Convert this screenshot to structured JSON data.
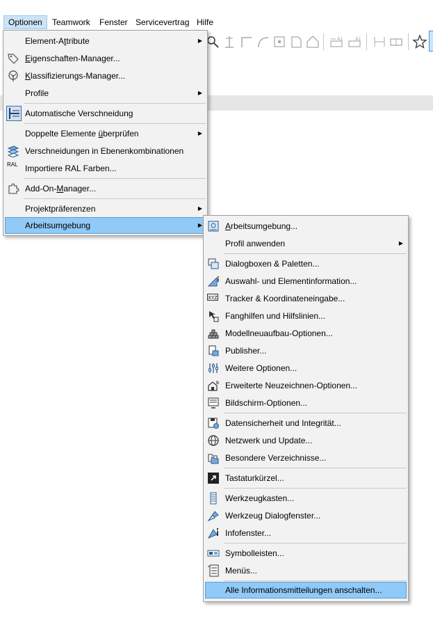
{
  "menubar": {
    "items": [
      "Optionen",
      "Teamwork",
      "Fenster",
      "Servicevertrag",
      "Hilfe"
    ]
  },
  "optionen_menu": {
    "items": [
      {
        "label": "Element-Attribute",
        "submenu": true
      },
      {
        "label": "Eigenschaften-Manager...",
        "icon": "tags-icon"
      },
      {
        "label": "Klassifizierungs-Manager...",
        "icon": "classification-tree-icon"
      },
      {
        "label": "Profile",
        "submenu": true
      },
      {
        "label": "Automatische Verschneidung",
        "icon": "auto-intersection-icon"
      },
      {
        "label": "Doppelte Elemente überprüfen",
        "submenu": true
      },
      {
        "label": "Verschneidungen in Ebenenkombinationen",
        "icon": "layer-intersection-icon"
      },
      {
        "label": "Importiere RAL Farben...",
        "icon": "ral-icon",
        "icon_text": "RAL"
      },
      {
        "label": "Add-On-Manager...",
        "icon": "puzzle-icon"
      },
      {
        "label": "Projektpräferenzen",
        "submenu": true
      },
      {
        "label": "Arbeitsumgebung",
        "submenu": true,
        "highlighted": true
      }
    ]
  },
  "arbeitsumgebung_menu": {
    "items": [
      {
        "label": "Arbeitsumgebung...",
        "icon": "work-environment-icon"
      },
      {
        "label": "Profil anwenden",
        "submenu": true
      },
      {
        "label": "Dialogboxen & Paletten...",
        "icon": "dialog-boxes-icon"
      },
      {
        "label": "Auswahl- und Elementinformation...",
        "icon": "selection-info-icon"
      },
      {
        "label": "Tracker & Koordinateneingabe...",
        "icon": "xyz-tracker-icon",
        "icon_text": "XYZ"
      },
      {
        "label": "Fanghilfen und Hilfslinien...",
        "icon": "snap-guides-icon"
      },
      {
        "label": "Modellneuaufbau-Optionen...",
        "icon": "model-rebuild-icon"
      },
      {
        "label": "Publisher...",
        "icon": "publisher-icon"
      },
      {
        "label": "Weitere Optionen...",
        "icon": "sliders-icon"
      },
      {
        "label": "Erweiterte Neuzeichnen-Optionen...",
        "icon": "redraw-options-icon"
      },
      {
        "label": "Bildschirm-Optionen...",
        "icon": "screen-options-icon"
      },
      {
        "label": "Datensicherheit und Integrität...",
        "icon": "data-safety-icon"
      },
      {
        "label": "Netzwerk und Update...",
        "icon": "globe-icon"
      },
      {
        "label": "Besondere Verzeichnisse...",
        "icon": "folders-icon"
      },
      {
        "label": "Tastaturkürzel...",
        "icon": "shortcut-icon"
      },
      {
        "label": "Werkzeugkasten...",
        "icon": "toolbox-icon"
      },
      {
        "label": "Werkzeug Dialogfenster...",
        "icon": "tool-dialog-icon"
      },
      {
        "label": "Infofenster...",
        "icon": "info-box-icon"
      },
      {
        "label": "Symbolleisten...",
        "icon": "toolbars-icon"
      },
      {
        "label": "Menüs...",
        "icon": "menus-icon"
      },
      {
        "label": "Alle Informationsmitteilungen anschalten...",
        "highlighted": true
      }
    ]
  },
  "colors": {
    "menu_bg": "#f2f2f2",
    "highlight": "#91c9f7",
    "menubar_active": "#cce4f7"
  }
}
